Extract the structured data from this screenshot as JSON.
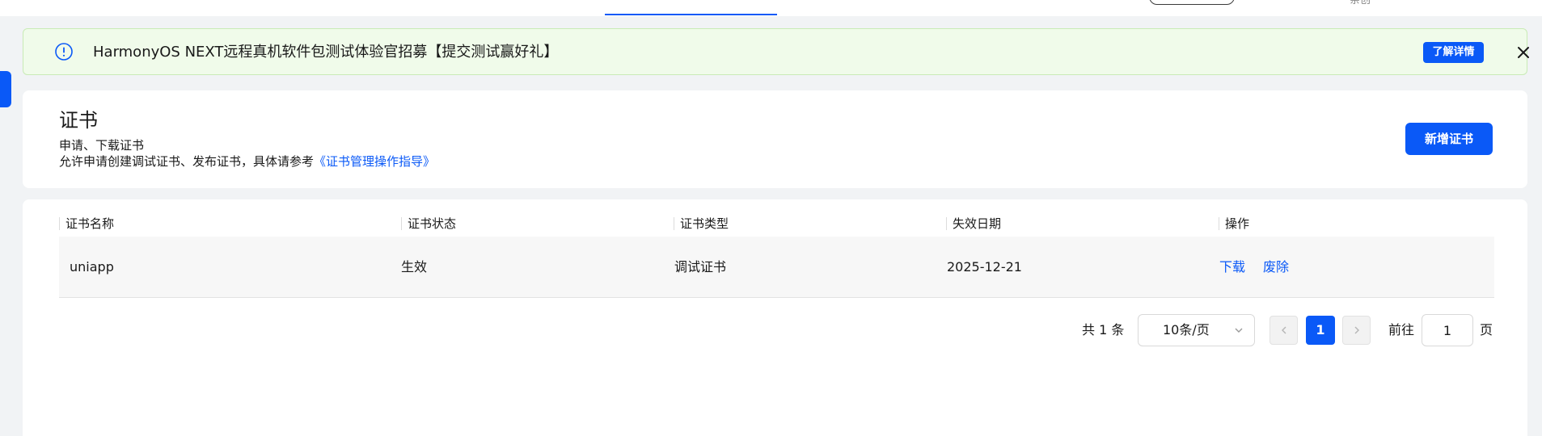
{
  "topbar": {
    "fragment_text": "亲创"
  },
  "notice": {
    "text": "HarmonyOS NEXT远程真机软件包测试体验官招募【提交测试赢好礼】",
    "details_button": "了解详情",
    "info_icon": "info-circle-icon",
    "close_icon": "close-icon"
  },
  "header": {
    "title": "证书",
    "subtitle": "申请、下载证书",
    "description_prefix": "允许申请创建调试证书、发布证书，具体请参考",
    "description_link": "《证书管理操作指导》",
    "add_button": "新增证书"
  },
  "table": {
    "columns": [
      "证书名称",
      "证书状态",
      "证书类型",
      "失效日期",
      "操作"
    ],
    "rows": [
      {
        "name": "uniapp",
        "status": "生效",
        "type": "调试证书",
        "expiry": "2025-12-21",
        "actions": [
          "下载",
          "废除"
        ]
      }
    ]
  },
  "pagination": {
    "total_label": "共 1 条",
    "page_size": "10条/页",
    "current_page": "1",
    "goto_prefix": "前往",
    "goto_value": "1",
    "goto_suffix": "页"
  },
  "colors": {
    "accent": "#0a59f7",
    "notice_bg": "#f0fbea",
    "notice_border": "#c9ebb6",
    "page_bg": "#f1f3f5"
  }
}
